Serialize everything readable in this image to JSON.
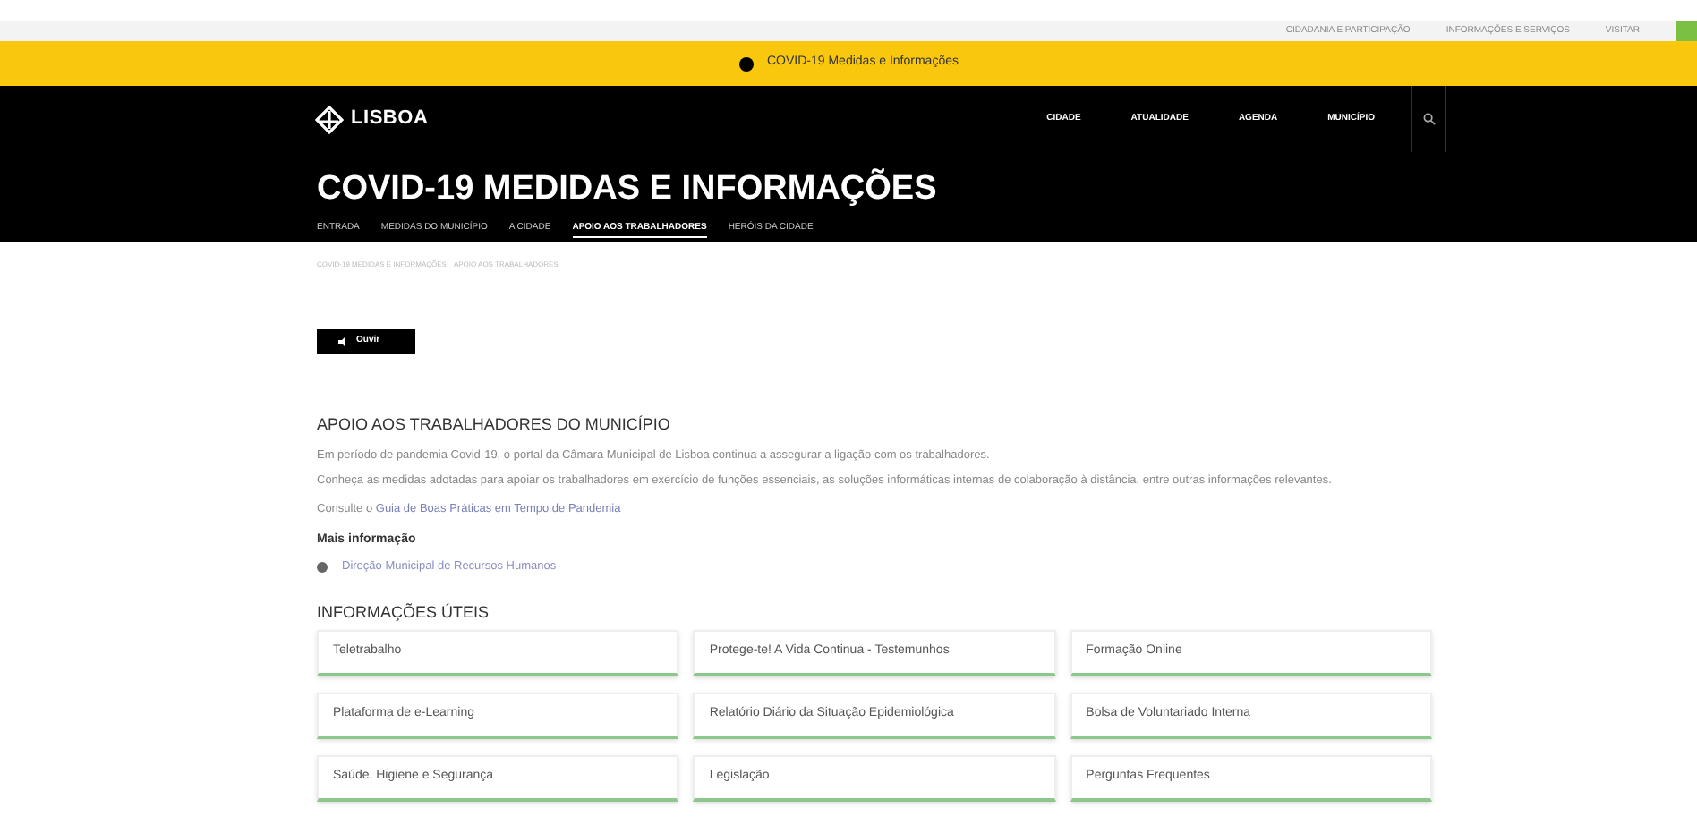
{
  "top_links": [
    "CIDADANIA E PARTICIPAÇÃO",
    "INFORMAÇÕES E SERVIÇOS",
    "VISITAR"
  ],
  "alert": {
    "text": "COVID-19 Medidas e Informações"
  },
  "logo": "LISBOA",
  "nav": [
    {
      "label": "CIDADE"
    },
    {
      "label": "ATUALIDADE"
    },
    {
      "label": "AGENDA"
    },
    {
      "label": "MUNICÍPIO"
    }
  ],
  "page_title": "COVID-19 MEDIDAS E INFORMAÇÕES",
  "subnav": [
    {
      "label": "ENTRADA",
      "selected": false
    },
    {
      "label": "MEDIDAS DO MUNICÍPIO",
      "selected": false
    },
    {
      "label": "A CIDADE",
      "selected": false
    },
    {
      "label": "APOIO AOS TRABALHADORES",
      "selected": true
    },
    {
      "label": "HERÓIS DA CIDADE",
      "selected": false
    }
  ],
  "breadcrumb": [
    "COVID-19 MEDIDAS E INFORMAÇÕES",
    "APOIO AOS TRABALHADORES"
  ],
  "listen_button": "Ouvir",
  "heading": "APOIO AOS TRABALHADORES DO MUNICÍPIO",
  "paragraphs": [
    "Em período de pandemia Covid-19, o portal da Câmara Municipal de Lisboa continua a assegurar a ligação com os trabalhadores.",
    "Conheça as medidas adotadas para apoiar os trabalhadores em exercício de funções essenciais, as soluções informáticas internas de colaboração à distância, entre outras informações relevantes."
  ],
  "consult": {
    "prefix": "Consulte o ",
    "link": "Guia de Boas Práticas em Tempo de Pandemia"
  },
  "more_info": {
    "title": "Mais informação",
    "link": "Direção Municipal de Recursos Humanos"
  },
  "useful_title": "INFORMAÇÕES ÚTEIS",
  "cards": [
    "Teletrabalho",
    "Protege-te! A Vida Continua - Testemunhos",
    "Formação Online",
    "Plataforma de e-Learning",
    "Relatório Diário da Situação Epidemiológica",
    "Bolsa de Voluntariado Interna",
    "Saúde, Higiene e Segurança",
    "Legislação",
    "Perguntas Frequentes"
  ]
}
